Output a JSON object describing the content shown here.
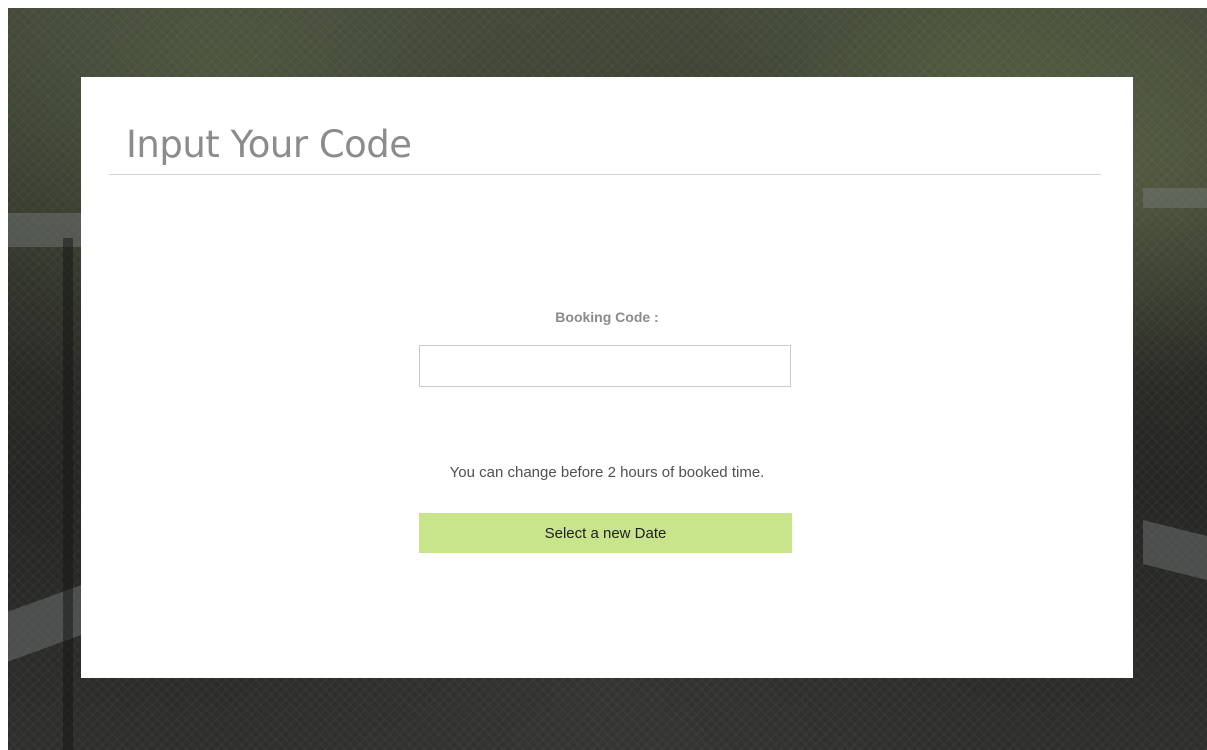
{
  "page": {
    "title": "Input Your Code"
  },
  "form": {
    "booking_code_label": "Booking Code :",
    "booking_code_value": "",
    "booking_code_placeholder": "",
    "notice": "You can change before 2 hours of booked time.",
    "submit_label": "Select a new Date"
  },
  "colors": {
    "button_background": "#c9e58c",
    "title_text": "#8c8c8c",
    "card_background": "#ffffff"
  }
}
